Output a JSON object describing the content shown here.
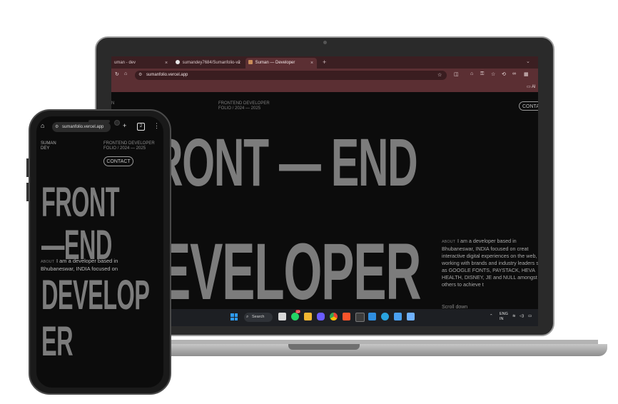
{
  "browser": {
    "tabs": [
      {
        "label": "uman - dev",
        "active": false
      },
      {
        "label": "sumandey7684/Sumanfolio-v2",
        "active": false
      },
      {
        "label": "Suman — Developer",
        "active": true
      }
    ],
    "new_tab": "+",
    "close": "×",
    "url": "sumanfolio.vercel.app",
    "bookmarks_label": "Al"
  },
  "site": {
    "name_line1": "SUMAN",
    "name_line2": "DEY",
    "name_fragment": "N",
    "role": "FRONTEND DEVELOPER",
    "folio": "FOLIO / 2024 — 2025",
    "contact": "CONTACT",
    "laptop_hero_line1": "RONT — END",
    "laptop_hero_line2": "EVELOPER",
    "phone_hero_lines": [
      "FRONT",
      "—END",
      "DEVELOP",
      "ER"
    ],
    "about_tag": "ABOUT",
    "laptop_about": "I am a developer based in Bhubaneswar, INDIA focused on creat interactive digital experiences on the web, working with brands and industry leaders such as GOOGLE FONTS, PAYSTACK, HEVA HEALTH, DISNEY, JE and NULL amongst others to achieve t",
    "phone_about": "I am a developer based in Bhubaneswar, INDIA focused on",
    "scroll": "Scroll down"
  },
  "taskbar": {
    "search": "Search",
    "badge": "12",
    "lang_line1": "ENG",
    "lang_line2": "IN",
    "colors": {
      "files": "#f2b632",
      "copilot": "#6a5cff",
      "chrome": "#3ea85a",
      "brave": "#fb542b",
      "vscode": "#2f8ee0",
      "telegram": "#2aa3df",
      "whatsapp": "#25d366"
    }
  },
  "phone": {
    "url": "sumanfolio.vercel.app",
    "tab_count": "2"
  },
  "colors": {
    "tab_bar": "#3b1f22",
    "toolbar": "#5b2f33",
    "page_bg": "#0c0c0c",
    "hero_text": "#7c7c7c"
  }
}
